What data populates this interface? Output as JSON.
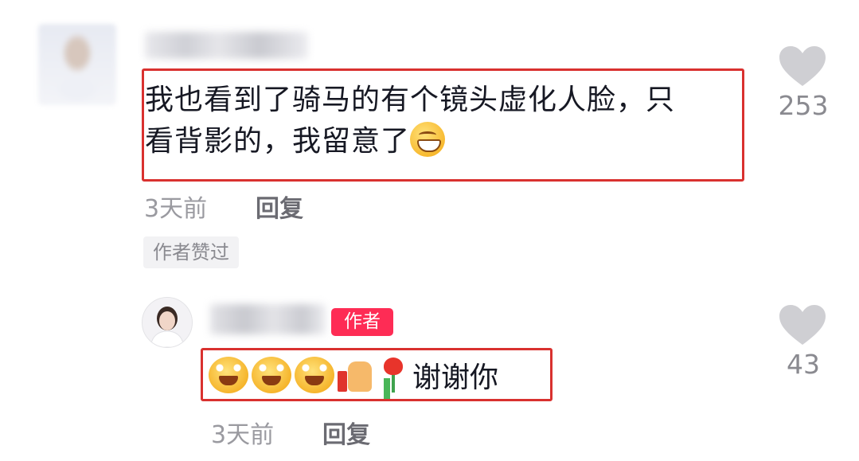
{
  "comment": {
    "text_line1": "我也看到了骑马的有个镜头虚化人脸，只",
    "text_line2": "看背影的，我留意了",
    "emoji_icon": "grinning-face-icon",
    "time": "3天前",
    "reply_label": "回复",
    "author_liked_tag": "作者赞过",
    "likes": "253"
  },
  "reply": {
    "author_badge": "作者",
    "emoji_icons": [
      "laughing-crying-face-icon",
      "laughing-crying-face-icon",
      "laughing-crying-face-icon",
      "thumbs-up-icon",
      "rose-icon"
    ],
    "text": "谢谢你",
    "time": "3天前",
    "reply_label": "回复",
    "likes": "43"
  },
  "colors": {
    "highlight_box": "#d9312f",
    "author_badge": "#fe2c55",
    "like_icon": "#cfcfd3"
  }
}
